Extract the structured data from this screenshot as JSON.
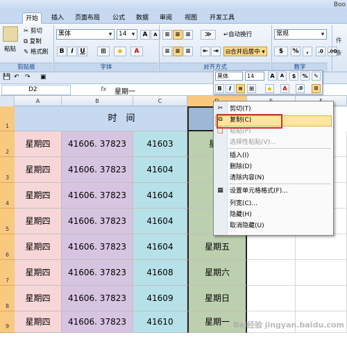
{
  "window": {
    "title_fragment": "Boo"
  },
  "tabs": [
    {
      "label": "开始",
      "active": true
    },
    {
      "label": "插入"
    },
    {
      "label": "页面布局"
    },
    {
      "label": "公式"
    },
    {
      "label": "数据"
    },
    {
      "label": "审阅"
    },
    {
      "label": "视图"
    },
    {
      "label": "开发工具"
    }
  ],
  "ribbon": {
    "paste": "粘贴",
    "cut": "剪切",
    "copy": "复制",
    "format_painter": "格式刷",
    "clipboard_group": "剪贴板",
    "font_name": "黑体",
    "font_size": "14",
    "font_group": "字体",
    "bold": "B",
    "italic": "I",
    "underline": "U",
    "grow": "A",
    "shrink": "A",
    "font_color": "A",
    "wrap_text": "自动换行",
    "merge_center": "合并后居中",
    "align_group": "对齐方式",
    "number_format": "常规",
    "number_group": "数字",
    "currency": "$",
    "percent": "%",
    "comma": ",",
    "styles_fragment": "样式",
    "styles_group_fragment": "件",
    "format_fragment": "条"
  },
  "formula_bar": {
    "name_box": "D2",
    "fx": "fx",
    "content": "星期一"
  },
  "columns": [
    {
      "label": ""
    },
    {
      "label": "A"
    },
    {
      "label": "B"
    },
    {
      "label": "C"
    },
    {
      "label": "D"
    },
    {
      "label": "E"
    },
    {
      "label": "F"
    }
  ],
  "rows": [
    "1",
    "2",
    "3",
    "4",
    "5",
    "6",
    "7",
    "8",
    "9"
  ],
  "header_merged": "时　间",
  "data": [
    [
      "星期四",
      "41606. 37823",
      "41603",
      "星期"
    ],
    [
      "星期四",
      "41606. 37823",
      "41604",
      "星"
    ],
    [
      "星期四",
      "41606. 37823",
      "41604",
      "星"
    ],
    [
      "星期四",
      "41606. 37823",
      "41604",
      "星"
    ],
    [
      "星期四",
      "41606. 37823",
      "41604",
      "星期五"
    ],
    [
      "星期四",
      "41606. 37823",
      "41608",
      "星期六"
    ],
    [
      "星期四",
      "41606. 37823",
      "41609",
      "星期日"
    ],
    [
      "星期四",
      "41606. 37823",
      "41610",
      "星期一"
    ]
  ],
  "mini_toolbar": {
    "font": "黑体",
    "size": "14",
    "bold": "B",
    "italic": "I"
  },
  "context_menu": [
    {
      "label": "剪切(T)",
      "icon": "cut-icon"
    },
    {
      "label": "复制(C)",
      "icon": "copy-icon",
      "highlighted": true
    },
    {
      "label": "粘贴(P)",
      "icon": "paste-icon",
      "disabled": true
    },
    {
      "label": "选择性粘贴(V)...",
      "disabled": true
    },
    {
      "label": "插入(I)"
    },
    {
      "label": "删除(D)"
    },
    {
      "label": "清除内容(N)"
    },
    {
      "label": "设置单元格格式(F)...",
      "icon": "format-cells-icon"
    },
    {
      "label": "列宽(C)..."
    },
    {
      "label": "隐藏(H)"
    },
    {
      "label": "取消隐藏(U)"
    }
  ],
  "watermark": "Bai经验 jingyan.baidu.com",
  "colors": {
    "col_a": "#f7d6d8",
    "col_b": "#d7c4e0",
    "col_c": "#b7e1e8",
    "col_d": "#bccfae",
    "row_header": "#f9c980"
  }
}
